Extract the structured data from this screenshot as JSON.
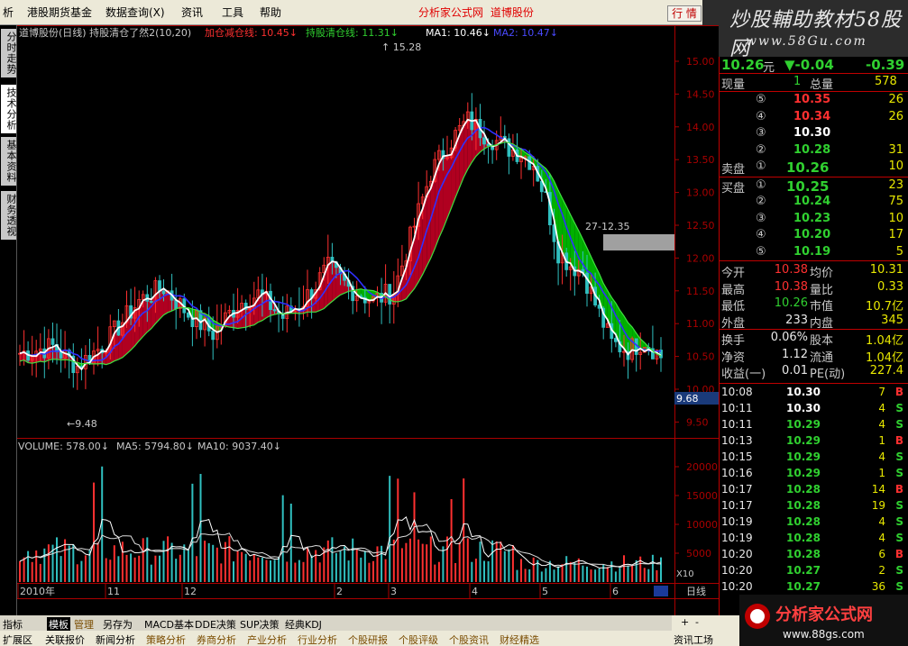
{
  "menubar": {
    "items": [
      "析",
      "港股期货基金",
      "数据查询(X)",
      "资讯",
      "工具",
      "帮助"
    ],
    "center_title": "分析家公式网",
    "stock_name": "道博股份",
    "hq_button": "行 情"
  },
  "brand": {
    "line1": "炒股輔助教材58股网",
    "line2": "www.58Gu.com"
  },
  "left_tabs": [
    "分时走势",
    "技术分析",
    "基本资料",
    "财务透视"
  ],
  "kline": {
    "title": "道博股份(日线) 持股清仓了然2(10,20)",
    "legend": [
      {
        "label": "加仓减仓线:",
        "value": "10.45",
        "color": "#ff3030"
      },
      {
        "label": "持股清仓线:",
        "value": "11.31",
        "color": "#30d030"
      },
      {
        "label": "MA1:",
        "value": "10.46",
        "color": "#ffffff"
      },
      {
        "label": "MA2:",
        "value": "10.47",
        "color": "#4a4aff"
      }
    ],
    "high_label": "15.28",
    "low_label": "9.48",
    "side_label": "27-12.35",
    "price_ticks": [
      "15.00",
      "14.50",
      "14.00",
      "13.50",
      "13.00",
      "12.50",
      "12.00",
      "11.50",
      "11.00",
      "10.50",
      "10.00",
      "9.50"
    ],
    "current_price_box": "9.68"
  },
  "volume": {
    "legend": [
      {
        "label": "VOLUME:",
        "value": "578.00"
      },
      {
        "label": "MA5:",
        "value": "5794.80"
      },
      {
        "label": "MA10:",
        "value": "9037.40"
      }
    ],
    "ticks": [
      "20000",
      "15000",
      "10000",
      "5000"
    ],
    "unit": "X10"
  },
  "dates": [
    "2010年",
    "11",
    "12",
    "2",
    "3",
    "4",
    "5",
    "6"
  ],
  "date_right": "日线",
  "quote": {
    "price": "10.26",
    "unit": "元",
    "change": "▼-0.04",
    "pct": "-0.39",
    "vol_now_label": "现量",
    "vol_now": "1",
    "vol_total_label": "总量",
    "vol_total": "578",
    "sell": [
      {
        "n": "⑤",
        "price": "10.35",
        "vol": "26"
      },
      {
        "n": "④",
        "price": "10.34",
        "vol": "26"
      },
      {
        "n": "③",
        "price": "10.30",
        "vol": ""
      },
      {
        "n": "②",
        "price": "10.28",
        "vol": "31"
      },
      {
        "label": "卖盘",
        "n": "①",
        "price": "10.26",
        "vol": "10"
      }
    ],
    "buy": [
      {
        "label": "买盘",
        "n": "①",
        "price": "10.25",
        "vol": "23"
      },
      {
        "n": "②",
        "price": "10.24",
        "vol": "75"
      },
      {
        "n": "③",
        "price": "10.23",
        "vol": "10"
      },
      {
        "n": "④",
        "price": "10.20",
        "vol": "17"
      },
      {
        "n": "⑤",
        "price": "10.19",
        "vol": "5"
      }
    ],
    "stats": [
      {
        "l1": "今开",
        "v1": "10.38",
        "l2": "均价",
        "v2": "10.31"
      },
      {
        "l1": "最高",
        "v1": "10.38",
        "l2": "量比",
        "v2": "0.33"
      },
      {
        "l1": "最低",
        "v1": "10.26",
        "l2": "市值",
        "v2": "10.7亿"
      },
      {
        "l1": "外盘",
        "v1": "233",
        "l2": "内盘",
        "v2": "345"
      }
    ],
    "stats2": [
      {
        "l1": "换手",
        "v1": "0.06%",
        "l2": "股本",
        "v2": "1.04亿"
      },
      {
        "l1": "净资",
        "v1": "1.12",
        "l2": "流通",
        "v2": "1.04亿"
      },
      {
        "l1": "收益(一)",
        "v1": "0.01",
        "l2": "PE(动)",
        "v2": "227.4"
      }
    ]
  },
  "ticks": [
    {
      "t": "10:08",
      "p": "10.30",
      "v": "7",
      "s": "B"
    },
    {
      "t": "10:11",
      "p": "10.30",
      "v": "4",
      "s": "S"
    },
    {
      "t": "10:11",
      "p": "10.29",
      "v": "4",
      "s": "S"
    },
    {
      "t": "10:13",
      "p": "10.29",
      "v": "1",
      "s": "B"
    },
    {
      "t": "10:15",
      "p": "10.29",
      "v": "4",
      "s": "S"
    },
    {
      "t": "10:16",
      "p": "10.29",
      "v": "1",
      "s": "S"
    },
    {
      "t": "10:17",
      "p": "10.28",
      "v": "14",
      "s": "B"
    },
    {
      "t": "10:17",
      "p": "10.28",
      "v": "19",
      "s": "S"
    },
    {
      "t": "10:19",
      "p": "10.28",
      "v": "4",
      "s": "S"
    },
    {
      "t": "10:19",
      "p": "10.28",
      "v": "4",
      "s": "S"
    },
    {
      "t": "10:20",
      "p": "10.28",
      "v": "6",
      "s": "B"
    },
    {
      "t": "10:20",
      "p": "10.27",
      "v": "2",
      "s": "S"
    },
    {
      "t": "10:20",
      "p": "10.27",
      "v": "36",
      "s": "S"
    }
  ],
  "bottom_tabs1": [
    "指标",
    "模板",
    "管理",
    "另存为",
    "MACD基本",
    "DDE决策",
    "SUP决策",
    "经典KDJ"
  ],
  "bottom_tabs2": [
    "扩展区",
    "关联报价",
    "新闻分析",
    "策略分析",
    "券商分析",
    "产业分析",
    "行业分析",
    "个股研报",
    "个股评级",
    "个股资讯",
    "财经精选"
  ],
  "bottom_right": {
    "label": "资讯工场",
    "plus": "+",
    "minus": "-",
    "zero": "0"
  },
  "logo": {
    "text": "分析家公式网",
    "url": "www.88gs.com"
  }
}
